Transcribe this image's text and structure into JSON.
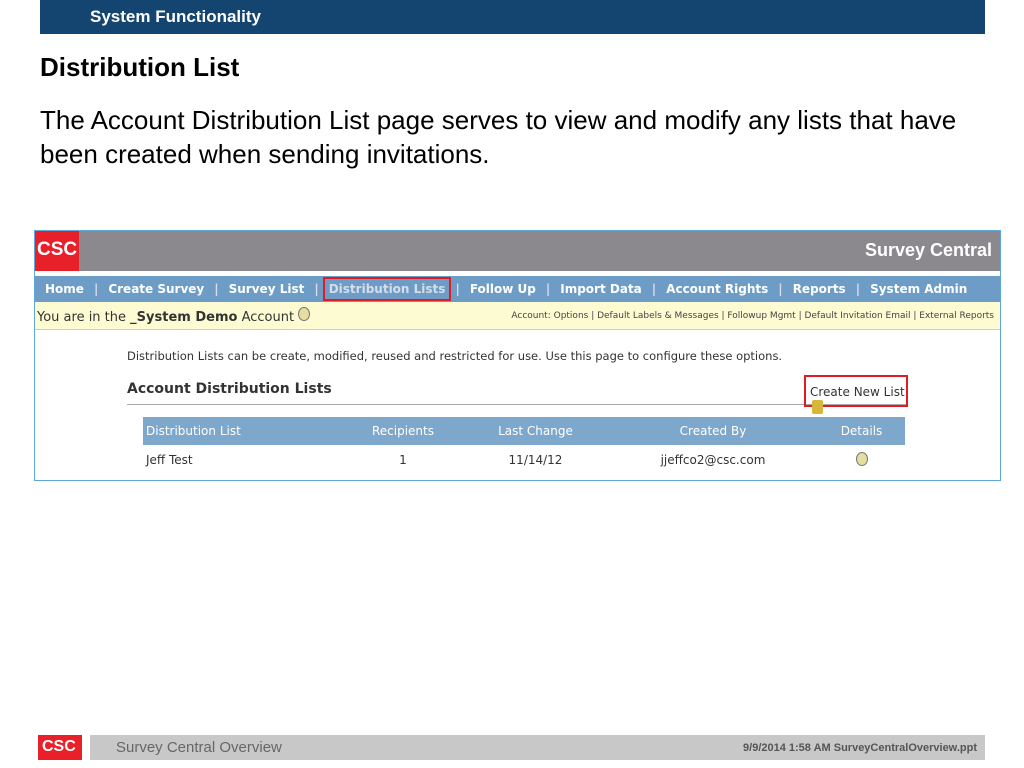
{
  "slide": {
    "section": "System Functionality",
    "title": "Distribution List",
    "body": "The Account Distribution List page serves to view and modify any lists that have been created when sending invitations."
  },
  "app": {
    "logo": "CSC",
    "name": "Survey Central",
    "nav": [
      "Home",
      "Create Survey",
      "Survey List",
      "Distribution Lists",
      "Follow Up",
      "Import Data",
      "Account Rights",
      "Reports",
      "System Admin"
    ],
    "account_prefix": "You are in the",
    "account_name": "_System Demo",
    "account_suffix": "Account",
    "account_links": "Account: Options | Default Labels & Messages | Followup Mgmt | Default Invitation Email | External Reports",
    "description": "Distribution Lists can be create, modified, reused and restricted for use. Use this page to configure these options.",
    "heading": "Account Distribution Lists",
    "create_new": "Create New List",
    "columns": [
      "Distribution List",
      "Recipients",
      "Last Change",
      "Created By",
      "Details"
    ],
    "rows": [
      {
        "name": "Jeff Test",
        "recipients": "1",
        "last_change": "11/14/12",
        "created_by": "jjeffco2@csc.com"
      }
    ]
  },
  "footer": {
    "logo": "CSC",
    "title": "Survey Central Overview",
    "meta": "9/9/2014 1:58 AM   SurveyCentralOverview.ppt"
  }
}
